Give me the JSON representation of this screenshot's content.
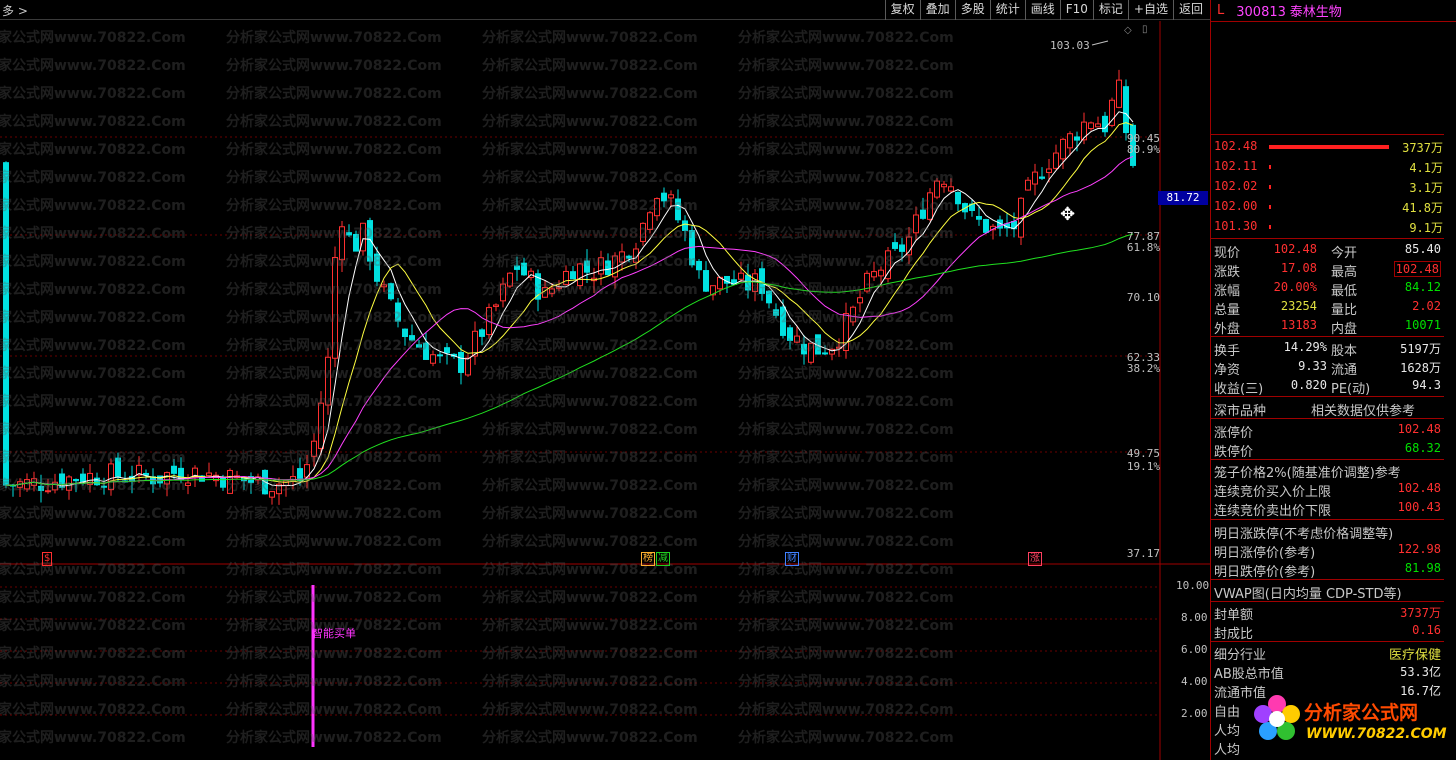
{
  "topbar": {
    "left_label": "多 >",
    "buttons": [
      "复权",
      "叠加",
      "多股",
      "统计",
      "画线",
      "F10",
      "标记",
      "+自选",
      "返回"
    ]
  },
  "stock": {
    "flag": "L",
    "code": "300813",
    "name": "泰林生物"
  },
  "chart": {
    "price_ticks": [
      "90.45",
      "77.87",
      "70.10",
      "62.33",
      "49.75",
      "37.17"
    ],
    "pct_ticks": [
      "80.9%",
      "61.8%",
      "38.2%",
      "19.1%"
    ],
    "current_price_tag": "81.72",
    "high_label": "103.03",
    "event_marks": [
      {
        "text": "$",
        "color": "#ff3030"
      },
      {
        "text": "榜",
        "color": "#ffb030"
      },
      {
        "text": "减",
        "color": "#20d020"
      },
      {
        "text": "财",
        "color": "#4080ff"
      },
      {
        "text": "涨",
        "color": "#ff4060"
      }
    ],
    "watermark": "分析家公式网www.70822.Com",
    "colors": {
      "up": "#ff3030",
      "down": "#00e0e0",
      "ma5": "#ffffff",
      "ma10": "#ffff40",
      "ma20": "#ff40ff",
      "ma60": "#20e020"
    }
  },
  "subchart": {
    "ticks": [
      "10.00",
      "8.00",
      "6.00",
      "4.00",
      "2.00"
    ],
    "signal_label": "智能买单",
    "signal_color": "#ff33ff"
  },
  "order_book": [
    {
      "price": "102.48",
      "vol": "3737万"
    },
    {
      "price": "102.11",
      "vol": "4.1万"
    },
    {
      "price": "102.02",
      "vol": "3.1万"
    },
    {
      "price": "102.00",
      "vol": "41.8万"
    },
    {
      "price": "101.30",
      "vol": "9.1万"
    }
  ],
  "quote": {
    "xianjia_k": "现价",
    "xianjia_v": "102.48",
    "jinkai_k": "今开",
    "jinkai_v": "85.40",
    "zhangdie_k": "涨跌",
    "zhangdie_v": "17.08",
    "zuigao_k": "最高",
    "zuigao_v": "102.48",
    "zhangfu_k": "涨幅",
    "zhangfu_v": "20.00%",
    "zuidi_k": "最低",
    "zuidi_v": "84.12",
    "zongliang_k": "总量",
    "zongliang_v": "23254",
    "liangbi_k": "量比",
    "liangbi_v": "2.02",
    "waipan_k": "外盘",
    "waipan_v": "13183",
    "neipan_k": "内盘",
    "neipan_v": "10071",
    "huanshou_k": "换手",
    "huanshou_v": "14.29%",
    "guben_k": "股本",
    "guben_v": "5197万",
    "jingzi_k": "净资",
    "jingzi_v": "9.33",
    "liutong_k": "流通",
    "liutong_v": "1628万",
    "shouyi_k": "收益(三)",
    "shouyi_v": "0.820",
    "pe_k": "PE(动)",
    "pe_v": "94.3"
  },
  "market": {
    "title": "深市品种",
    "note": "相关数据仅供参考",
    "zhangting_k": "涨停价",
    "zhangting_v": "102.48",
    "dieting_k": "跌停价",
    "dieting_v": "68.32",
    "cage_k": "笼子价格2%(随基准价调整)参考",
    "buy_k": "连续竞价买入价上限",
    "buy_v": "102.48",
    "sell_k": "连续竞价卖出价下限",
    "sell_v": "100.43"
  },
  "tomorrow": {
    "title": "明日涨跌停(不考虑价格调整等)",
    "up_k": "明日涨停价(参考)",
    "up_v": "122.98",
    "down_k": "明日跌停价(参考)",
    "down_v": "81.98"
  },
  "vwap": {
    "title": "VWAP图(日内均量 CDP-STD等)",
    "fengdan_k": "封单额",
    "fengdan_v": "3737万",
    "fengcheng_k": "封成比",
    "fengcheng_v": "0.16",
    "industry_k": "细分行业",
    "industry_v": "医疗保健",
    "ab_k": "AB股总市值",
    "ab_v": "53.3亿",
    "lt_k": "流通市值",
    "lt_v": "16.7亿",
    "ziyou_k": "自由",
    "renjun1_k": "人均",
    "renjun2_k": "人均"
  },
  "logo": {
    "title": "分析家公式网",
    "url": "WWW.70822.COM"
  }
}
